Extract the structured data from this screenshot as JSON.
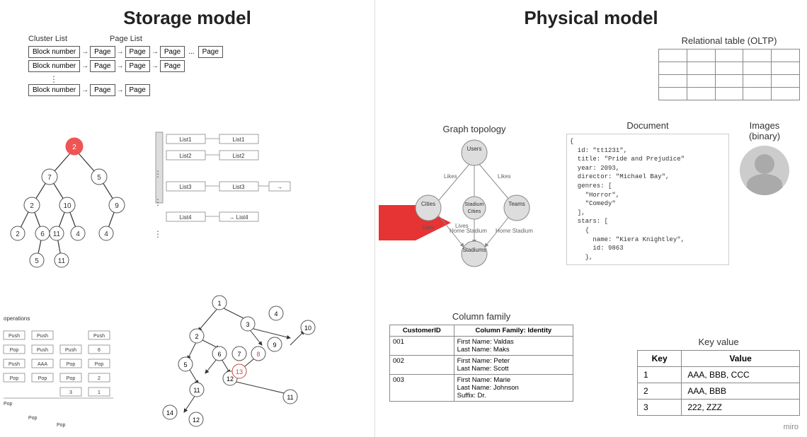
{
  "storage": {
    "title": "Storage model",
    "cluster_label": "Cluster List",
    "page_label": "Page  List",
    "rows": [
      {
        "block": "Block number",
        "pages": [
          "Page",
          "Page",
          "Page"
        ],
        "has_dots": true,
        "extra_page": "Page"
      },
      {
        "block": "Block number",
        "pages": [
          "Page",
          "Page",
          "Page"
        ],
        "has_dots": false,
        "extra_page": null
      },
      {
        "block": "Block number",
        "pages": [
          "Page",
          "Page"
        ],
        "has_dots": false,
        "extra_page": null
      }
    ],
    "block_label": "Block"
  },
  "physical": {
    "title": "Physical model",
    "relational_table_title": "Relational table (OLTP)",
    "graph_topology_title": "Graph topology",
    "document_title": "Document",
    "document_content": "{\n  id: \"tt1231\",\n  title: \"Pride and Prejudice\"\n  year: 2093,\n  director: \"Michael Bay\",\n  genres: [\n    \"Horror\",\n    \"Comedy\"\n  ],\n  stars: [\n    {\n      name: \"Kiera Knightley\",\n      id: 9863\n    },",
    "images_title": "Images\n(binary)",
    "column_family_title": "Column family",
    "column_family_headers": [
      "CustomerID",
      "Column Family: Identity"
    ],
    "column_family_rows": [
      {
        "id": "001",
        "value": "First Name: Valdas\nLast Name: Maks"
      },
      {
        "id": "002",
        "value": "First Name: Peter\nLast Name: Scott"
      },
      {
        "id": "003",
        "value": "First Name: Marie\nLast Name: Johnson\nSuffix: Dr."
      }
    ],
    "key_value_title": "Key value",
    "key_value_headers": [
      "Key",
      "Value"
    ],
    "key_value_rows": [
      {
        "key": "1",
        "value": "AAA, BBB, CCC"
      },
      {
        "key": "2",
        "value": "AAA, BBB"
      },
      {
        "key": "3",
        "value": "222, ZZZ"
      }
    ]
  },
  "miro_label": "miro"
}
